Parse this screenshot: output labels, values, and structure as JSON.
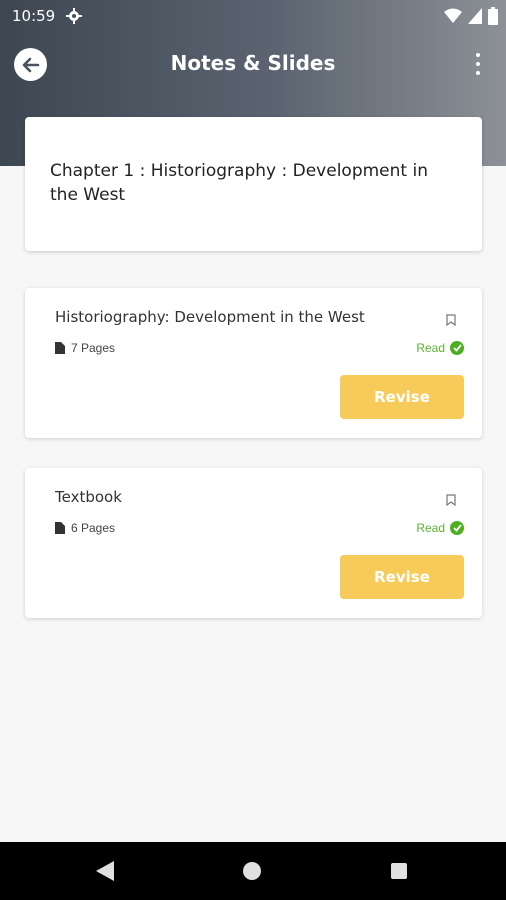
{
  "status_bar": {
    "time": "10:59"
  },
  "app_bar": {
    "title": "Notes & Slides"
  },
  "chapter": {
    "title": "Chapter 1 :  Historiography : Development in the West"
  },
  "documents": [
    {
      "title": "Historiography: Development in the West",
      "pages": "7 Pages",
      "status": "Read",
      "action_label": "Revise"
    },
    {
      "title": "Textbook",
      "pages": "6 Pages",
      "status": "Read",
      "action_label": "Revise"
    }
  ],
  "colors": {
    "accent": "#f6cb59",
    "read_green": "#5cb531",
    "header_dark": "#3d4752"
  }
}
